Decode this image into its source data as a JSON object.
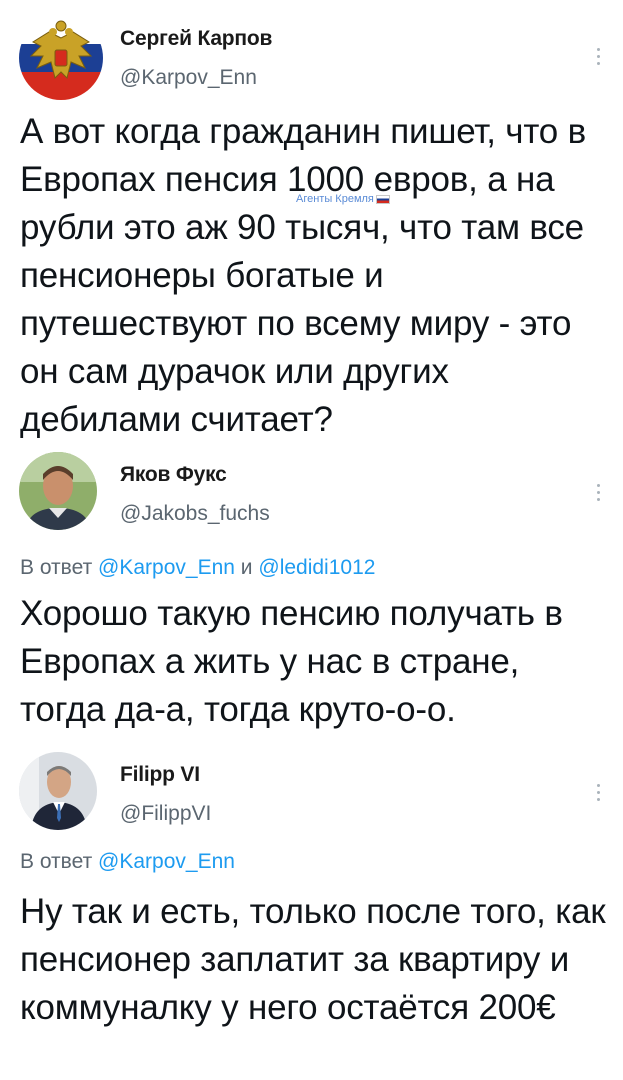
{
  "tweets": [
    {
      "author": {
        "display_name": "Сергей Карпов",
        "handle": "@Karpov_Enn",
        "avatar_icon": "russian-coat-of-arms-avatar"
      },
      "text": "А вот когда гражданин пишет, что в Европах пенсия 1000 евров, а на рубли это аж 90 тысяч, что там все пенсионеры богатые и путешествуют по всему миру - это он сам дурачок или других дебилами считает?"
    },
    {
      "author": {
        "display_name": "Яков Фукс",
        "handle": "@Jakobs_fuchs",
        "avatar_icon": "man-portrait-avatar"
      },
      "reply_prefix": "В ответ",
      "reply_to_1": "@Karpov_Enn",
      "reply_connector": "и",
      "reply_to_2": "@ledidi1012",
      "text": "Хорошо такую пенсию получать в Европах а жить у нас в стране, тогда да-а, тогда круто-о-о."
    },
    {
      "author": {
        "display_name": "Filipp VI",
        "handle": "@FilippVI",
        "avatar_icon": "king-portrait-avatar"
      },
      "reply_prefix": "В ответ",
      "reply_to_1": "@Karpov_Enn",
      "text": "Ну так и есть, только после того, как пенсионер заплатит за квартиру и коммуналку у него остаётся 200€"
    }
  ],
  "watermark": {
    "text": "Агенты Кремля"
  },
  "colors": {
    "link": "#1d9bf0",
    "secondary_text": "#5b6670",
    "primary_text": "#0f1419"
  }
}
